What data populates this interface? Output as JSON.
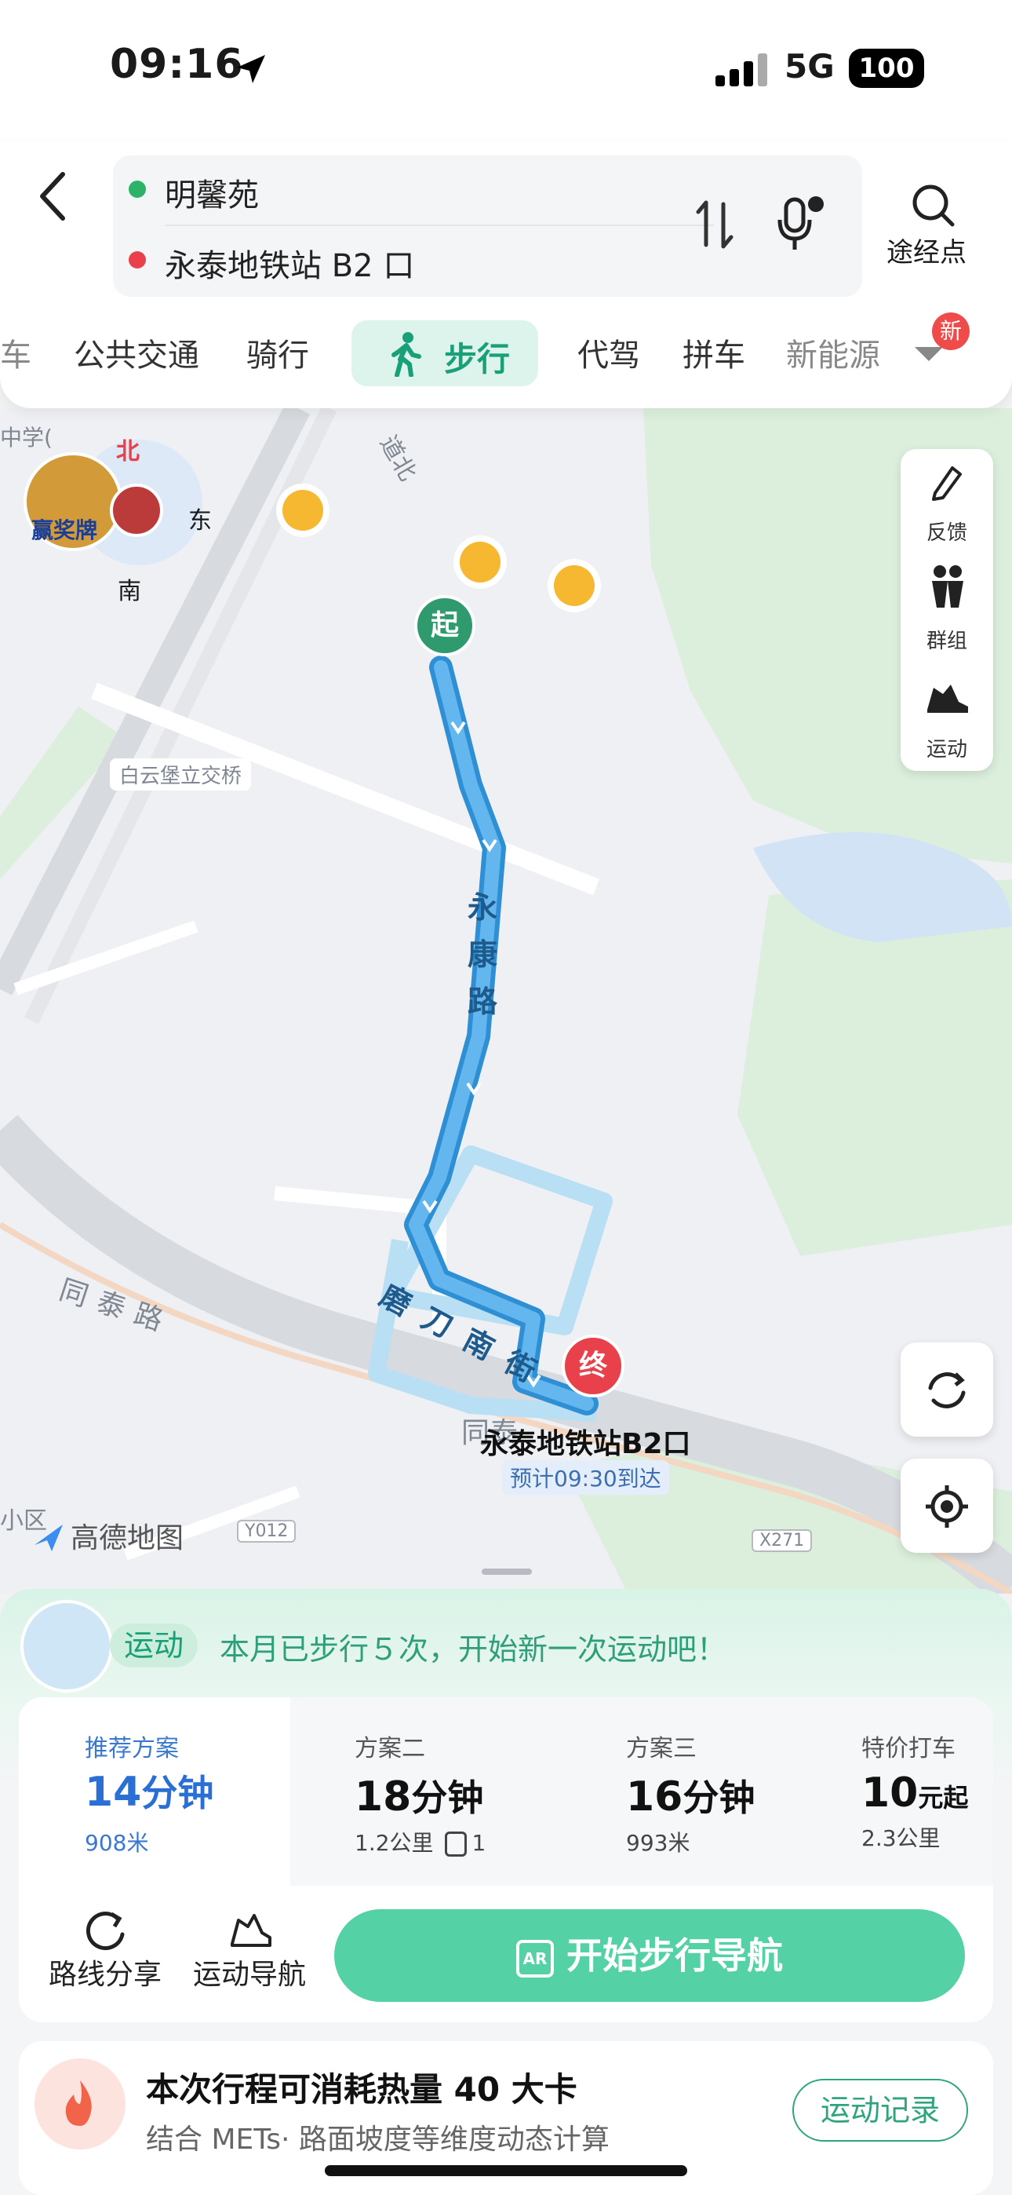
{
  "status": {
    "time": "09:16",
    "network": "5G",
    "battery": "100"
  },
  "route": {
    "origin": "明馨苑",
    "destination": "永泰地铁站 B2 口",
    "waypoint_label": "途经点"
  },
  "tabs": [
    {
      "label": "车"
    },
    {
      "label": "公共交通"
    },
    {
      "label": "骑行"
    },
    {
      "label": "步行",
      "active": true
    },
    {
      "label": "代驾"
    },
    {
      "label": "拼车"
    },
    {
      "label": "新能源"
    }
  ],
  "new_badge": "新",
  "map": {
    "compass": {
      "north": "北",
      "east": "东",
      "south": "南",
      "badge": "赢奖牌"
    },
    "start_marker": "起",
    "end_marker": "终",
    "end_name": "永泰地铁站B2口",
    "eta": "预计09:30到达",
    "road_labels": {
      "bridge": "白云堡立交桥",
      "yongkang": "永康路",
      "modao": "磨刀南街",
      "tongtai": "同泰路",
      "tongtai2": "同泰",
      "daobei": "道北",
      "school": "中学(",
      "xiaoqu": "小区",
      "y012": "Y012",
      "x271": "X271"
    },
    "brand": "高德地图",
    "side_panel": [
      {
        "label": "反馈",
        "icon": "pencil-icon"
      },
      {
        "label": "群组",
        "icon": "group-icon"
      },
      {
        "label": "运动",
        "icon": "shoe-icon"
      }
    ]
  },
  "sport_banner": {
    "tag": "运动",
    "message": "本月已步行５次，开始新一次运动吧！"
  },
  "plans": [
    {
      "title": "推荐方案",
      "time": "14",
      "unit": "分钟",
      "sub": "908米"
    },
    {
      "title": "方案二",
      "time": "18",
      "unit": "分钟",
      "sub": "1.2公里",
      "extra": "1"
    },
    {
      "title": "方案三",
      "time": "16",
      "unit": "分钟",
      "sub": "993米"
    },
    {
      "title": "特价打车",
      "time": "10",
      "unit": "元起",
      "sub": "2.3公里"
    }
  ],
  "actions": {
    "share": "路线分享",
    "sport_nav": "运动导航",
    "start": "开始步行导航"
  },
  "calories": {
    "title": "本次行程可消耗热量 40 大卡",
    "subtitle": "结合 METs· 路面坡度等维度动态计算",
    "record": "运动记录"
  },
  "colors": {
    "accent": "#1aa079",
    "route": "#4aa8e8",
    "start": "#2e9a6e",
    "end": "#e8414b",
    "button": "#55d1a6"
  }
}
